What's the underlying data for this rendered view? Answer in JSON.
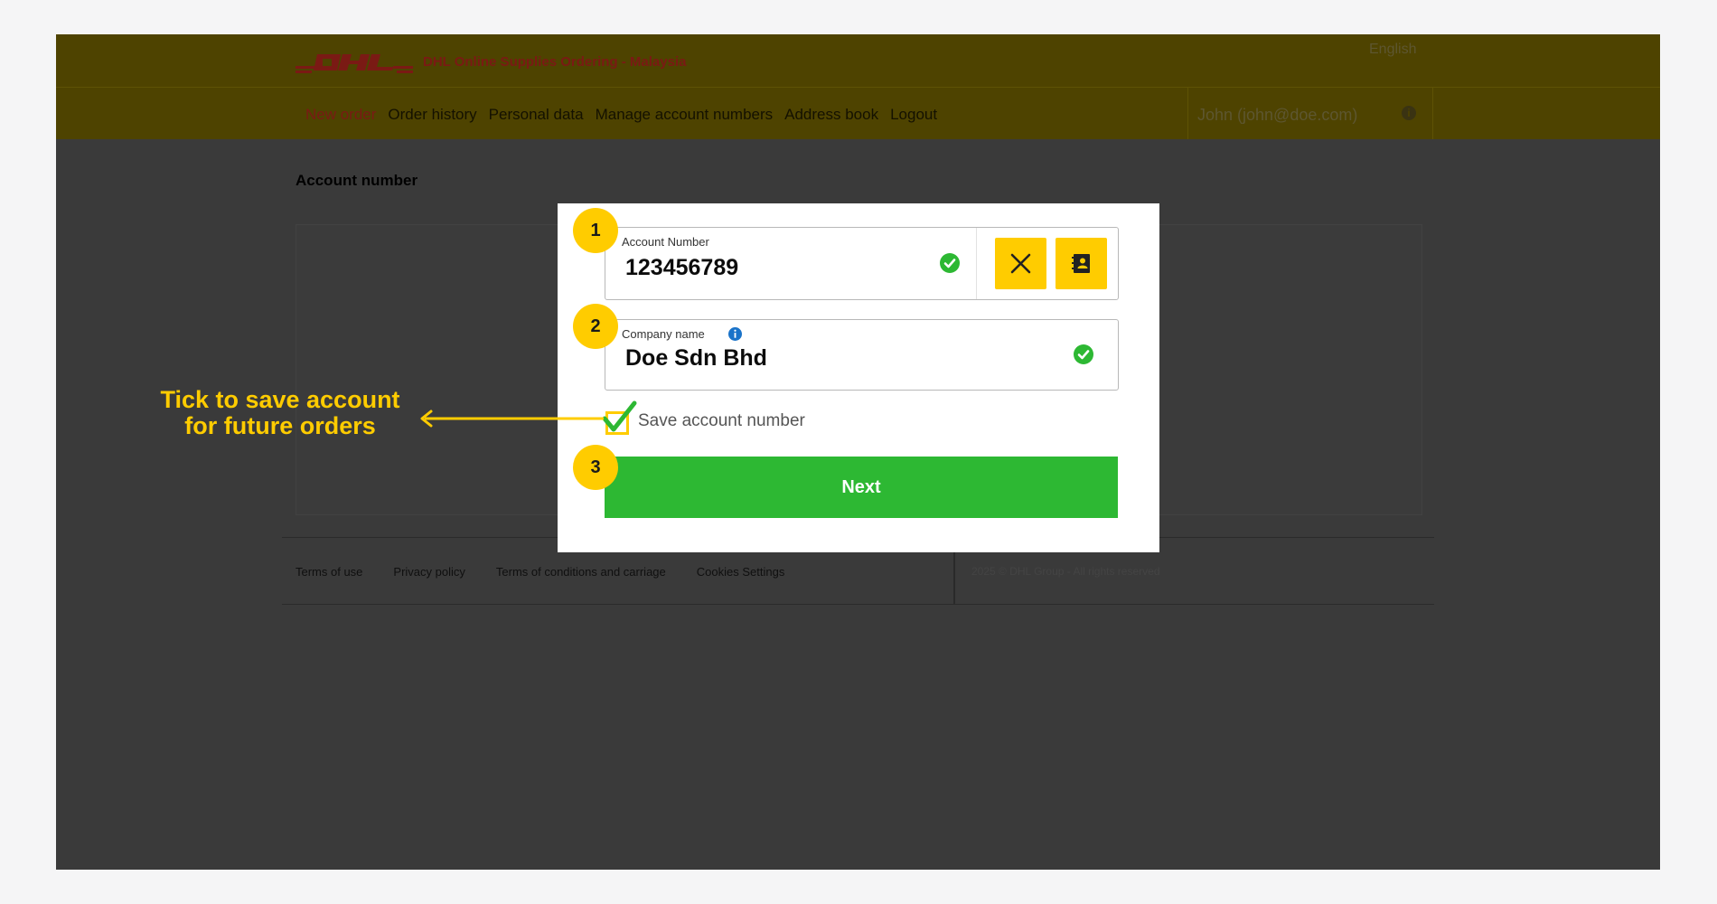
{
  "header": {
    "title": "DHL Online Supplies Ordering - Malaysia",
    "language": "English",
    "logo_icon": "dhl-logo-icon"
  },
  "nav": {
    "items": [
      "New order",
      "Order history",
      "Personal data",
      "Manage account numbers",
      "Address book",
      "Logout"
    ],
    "user": "John (john@doe.com)",
    "info_icon": "info-icon"
  },
  "page": {
    "section_label": "Account number"
  },
  "footer": {
    "links": [
      "Terms of use",
      "Privacy policy",
      "Terms of conditions and carriage",
      "Cookies Settings"
    ],
    "copyright": "2025 © DHL Group - All rights reserved"
  },
  "modal": {
    "account": {
      "label": "Account Number",
      "value": "123456789",
      "status_icon": "check-circle-icon",
      "clear_icon": "close-icon",
      "address_book_icon": "address-book-icon"
    },
    "company": {
      "label": "Company name",
      "value": "Doe Sdn Bhd",
      "info_icon": "info-icon",
      "status_icon": "check-circle-icon"
    },
    "save": {
      "label": "Save account number",
      "checked": true
    },
    "next_label": "Next"
  },
  "annotations": {
    "steps": [
      "1",
      "2",
      "3"
    ],
    "callout": "Tick to save account for future orders",
    "accent_color": "#ffcc00",
    "success_color": "#2db833"
  }
}
